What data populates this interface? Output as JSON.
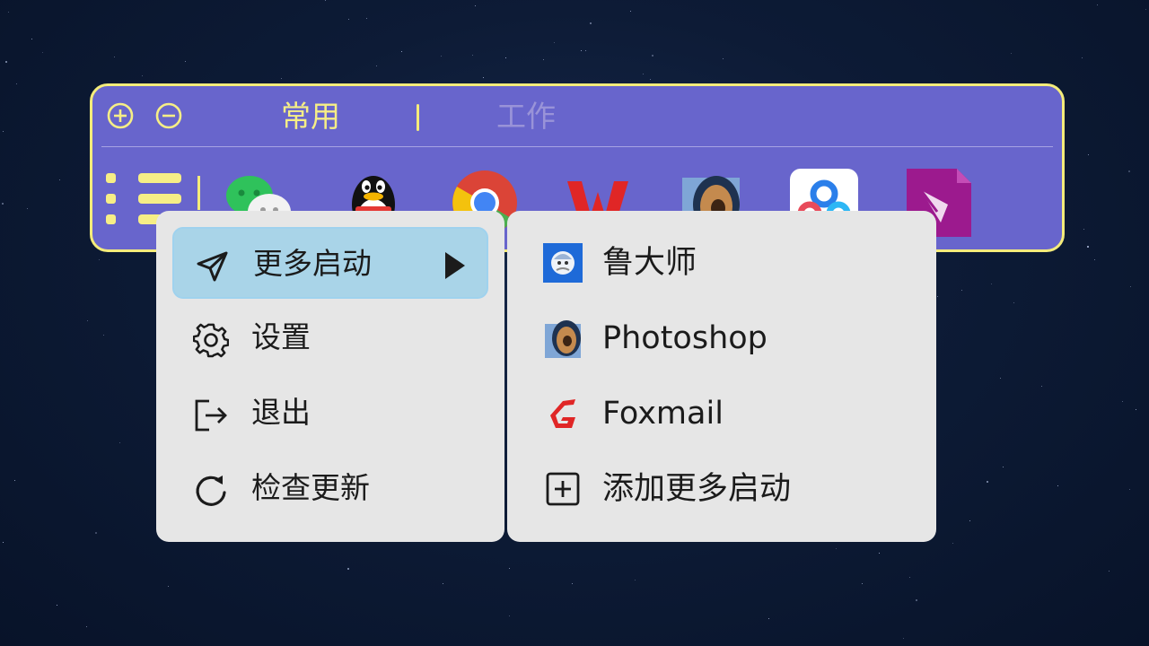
{
  "launcher": {
    "tabs": [
      {
        "label": "常用",
        "active": true
      },
      {
        "label": "工作",
        "active": false
      }
    ],
    "apps": [
      {
        "icon": "wechat-icon"
      },
      {
        "icon": "qq-icon"
      },
      {
        "icon": "chrome-icon"
      },
      {
        "icon": "wps-icon"
      },
      {
        "icon": "photoshop-icon"
      },
      {
        "icon": "baidu-netdisk-icon"
      },
      {
        "icon": "pen-document-icon"
      }
    ],
    "colors": {
      "bar": "#6865cc",
      "accent": "#f5ec7a"
    }
  },
  "menu": {
    "items": [
      {
        "label": "更多启动",
        "icon": "send-icon",
        "highlighted": true,
        "has_submenu": true
      },
      {
        "label": "设置",
        "icon": "gear-icon"
      },
      {
        "label": "退出",
        "icon": "logout-icon"
      },
      {
        "label": "检查更新",
        "icon": "refresh-icon"
      }
    ],
    "highlight_color": "#a9d4e8"
  },
  "submenu": {
    "items": [
      {
        "label": "鲁大师",
        "icon": "ludashi-icon"
      },
      {
        "label": "Photoshop",
        "icon": "photoshop-icon"
      },
      {
        "label": "Foxmail",
        "icon": "foxmail-icon"
      },
      {
        "label": "添加更多启动",
        "icon": "add-square-icon"
      }
    ]
  }
}
